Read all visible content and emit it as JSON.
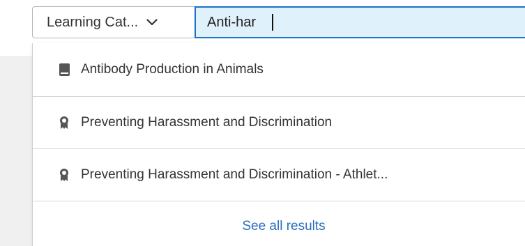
{
  "search": {
    "category_label": "Learning Cat...",
    "query": "Anti-har",
    "placeholder": ""
  },
  "results": [
    {
      "label": "Antibody Production in Animals",
      "icon": "book-icon"
    },
    {
      "label": "Preventing Harassment and Discrimination",
      "icon": "award-ribbon-icon"
    },
    {
      "label": "Preventing Harassment and Discrimination - Athlet...",
      "icon": "award-ribbon-icon"
    }
  ],
  "see_all_label": "See all results",
  "colors": {
    "accent": "#1a73c8",
    "input_bg": "#dff1fb",
    "link": "#2a6ebb",
    "text": "#333333"
  }
}
